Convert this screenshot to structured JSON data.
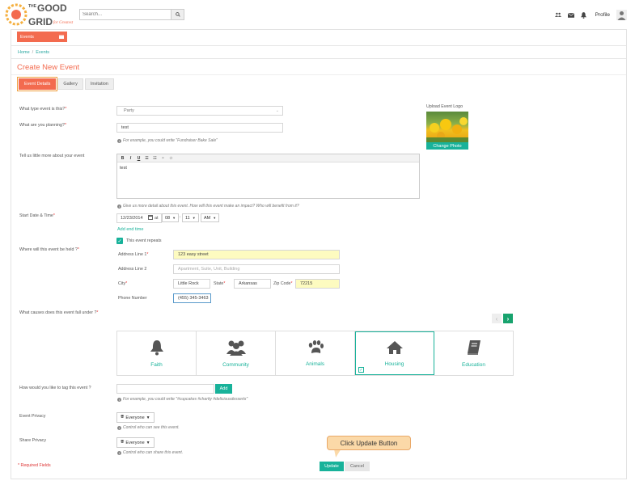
{
  "header": {
    "search_placeholder": "Search...",
    "profile_label": "Profile",
    "icons": [
      "users-icon",
      "mail-icon",
      "bell-icon",
      "avatar-icon"
    ]
  },
  "nav": {
    "events_tab": "Events"
  },
  "breadcrumb": {
    "home": "Home",
    "events": "Events"
  },
  "page_title": "Create New Event",
  "tabs": [
    "Event Details",
    "Gallery",
    "Invitation"
  ],
  "form": {
    "event_type_label": "What type event is this?",
    "event_type_value": "Party",
    "planning_label": "What are you planning?",
    "planning_value": "test",
    "planning_hint": "For example, you could write \"Fundraiser Bake Sale\"",
    "more_label": "Tell us little more about your event",
    "more_value": "test",
    "more_hint": "Give us more detail about this event. How will this event make an impact? Who will benefit from it?",
    "start_label": "Start Date & Time",
    "start_date": "12/23/2014",
    "at_label": "at",
    "hour": "08",
    "minute": "11",
    "ampm": "AM",
    "add_end_time": "Add end time",
    "repeats_label": "This event repeats",
    "where_label": "Where will this event be held ?",
    "address1_label": "Address Line 1",
    "address1_value": "123 easy street",
    "address2_label": "Address Line 2",
    "address2_placeholder": "Apartment, Suite, Unit, Building",
    "city_label": "City",
    "city_value": "Little Rock",
    "state_label": "State",
    "state_value": "Arkansas",
    "zip_label": "Zip Code",
    "zip_value": "72215",
    "phone_label": "Phone Number",
    "phone_value": "(455) 345-3463",
    "causes_label": "What causes does this event fall under ?",
    "causes": [
      {
        "name": "Faith",
        "icon": "bell-icon",
        "selected": false
      },
      {
        "name": "Community",
        "icon": "group-icon",
        "selected": false
      },
      {
        "name": "Animals",
        "icon": "paw-icon",
        "selected": false
      },
      {
        "name": "Housing",
        "icon": "house-icon",
        "selected": true
      },
      {
        "name": "Education",
        "icon": "book-icon",
        "selected": false
      }
    ],
    "tag_label": "How would you like to tag this event ?",
    "tag_add": "Add",
    "tag_hint": "For example, you could write \"#cupcakes #charity #deliciousdesserts\"",
    "privacy_label": "Event Privacy",
    "privacy_value": "Everyone",
    "privacy_hint": "Control who can see this event.",
    "share_label": "Share Privacy",
    "share_value": "Everyone",
    "share_hint": "Control who can share this event.",
    "required_note": "* Required Fields",
    "update_btn": "Update",
    "cancel_btn": "Cancel"
  },
  "upload": {
    "label": "Upload Event Logo",
    "change": "Change Photo"
  },
  "callout": "Click Update Button",
  "colors": {
    "accent": "#f36b4f",
    "teal": "#18b29a"
  }
}
